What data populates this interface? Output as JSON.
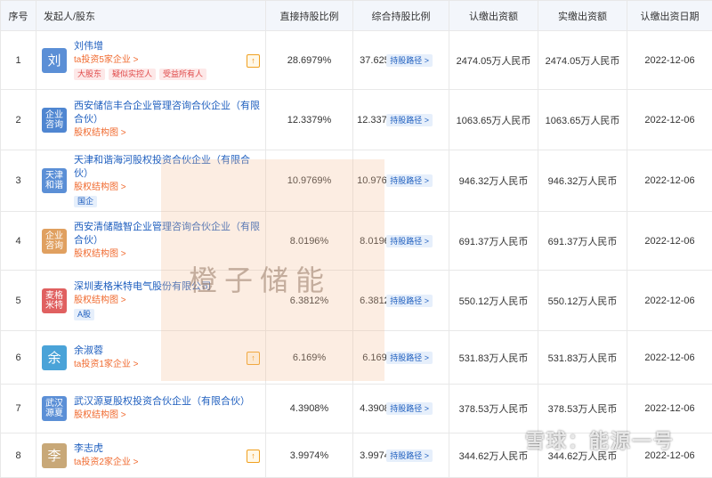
{
  "headers": {
    "index": "序号",
    "holder": "发起人/股东",
    "direct": "直接持股比例",
    "combined": "综合持股比例",
    "subscribed": "认缴出资额",
    "paid": "实缴出资额",
    "date": "认缴出资日期"
  },
  "path_label": "持股路径 >",
  "follow_icon": "follow-icon",
  "rows": [
    {
      "index": "1",
      "avatar": "刘",
      "avatar_color": "#5b8fd6",
      "avatar_type": "person",
      "name": "刘伟增",
      "sub": "ta投资5家企业 >",
      "tags": [
        {
          "text": "大股东",
          "style": "red"
        },
        {
          "text": "疑似实控人",
          "style": "red"
        },
        {
          "text": "受益所有人",
          "style": "red"
        }
      ],
      "has_follow": true,
      "direct": "28.6979%",
      "combined": "37.625%",
      "subscribed": "2474.05万人民币",
      "paid": "2474.05万人民币",
      "date": "2022-12-06"
    },
    {
      "index": "2",
      "avatar": "企业\n咨询",
      "avatar_color": "#4f86d1",
      "avatar_type": "company",
      "name": "西安储信丰合企业管理咨询合伙企业（有限合伙）",
      "sub": "股权结构图 >",
      "tags": [],
      "has_follow": false,
      "direct": "12.3379%",
      "combined": "12.3379%",
      "subscribed": "1063.65万人民币",
      "paid": "1063.65万人民币",
      "date": "2022-12-06"
    },
    {
      "index": "3",
      "avatar": "天津\n和谐",
      "avatar_color": "#5b8fd6",
      "avatar_type": "company",
      "name": "天津和谐海河股权投资合伙企业（有限合伙）",
      "sub": "股权结构图 >",
      "tags": [
        {
          "text": "国企",
          "style": "blue"
        }
      ],
      "has_follow": false,
      "direct": "10.9769%",
      "combined": "10.9769%",
      "subscribed": "946.32万人民币",
      "paid": "946.32万人民币",
      "date": "2022-12-06"
    },
    {
      "index": "4",
      "avatar": "企业\n咨询",
      "avatar_color": "#e0a060",
      "avatar_type": "company",
      "name": "西安清储融智企业管理咨询合伙企业（有限合伙）",
      "sub": "股权结构图 >",
      "tags": [],
      "has_follow": false,
      "direct": "8.0196%",
      "combined": "8.0196%",
      "subscribed": "691.37万人民币",
      "paid": "691.37万人民币",
      "date": "2022-12-06"
    },
    {
      "index": "5",
      "avatar": "麦格\n米特",
      "avatar_color": "#e06060",
      "avatar_type": "company",
      "name": "深圳麦格米特电气股份有限公司",
      "sub": "股权结构图 >",
      "tags": [
        {
          "text": "A股",
          "style": "blue"
        }
      ],
      "has_follow": false,
      "direct": "6.3812%",
      "combined": "6.3812%",
      "subscribed": "550.12万人民币",
      "paid": "550.12万人民币",
      "date": "2022-12-06"
    },
    {
      "index": "6",
      "avatar": "余",
      "avatar_color": "#4aa3d8",
      "avatar_type": "person",
      "name": "余淑蓉",
      "sub": "ta投资1家企业 >",
      "tags": [],
      "has_follow": true,
      "direct": "6.169%",
      "combined": "6.169%",
      "subscribed": "531.83万人民币",
      "paid": "531.83万人民币",
      "date": "2022-12-06"
    },
    {
      "index": "7",
      "avatar": "武汉\n源夏",
      "avatar_color": "#5b8fd6",
      "avatar_type": "company",
      "name": "武汉源夏股权投资合伙企业（有限合伙）",
      "sub": "股权结构图 >",
      "tags": [],
      "has_follow": false,
      "direct": "4.3908%",
      "combined": "4.3908%",
      "subscribed": "378.53万人民币",
      "paid": "378.53万人民币",
      "date": "2022-12-06"
    },
    {
      "index": "8",
      "avatar": "李",
      "avatar_color": "#c8a878",
      "avatar_type": "person",
      "name": "李志虎",
      "sub": "ta投资2家企业 >",
      "tags": [],
      "has_follow": true,
      "direct": "3.9974%",
      "combined": "3.9974%",
      "subscribed": "344.62万人民币",
      "paid": "344.62万人民币",
      "date": "2022-12-06"
    }
  ],
  "watermark": "橙子储能",
  "corner_watermark": "雪球：能源一号"
}
